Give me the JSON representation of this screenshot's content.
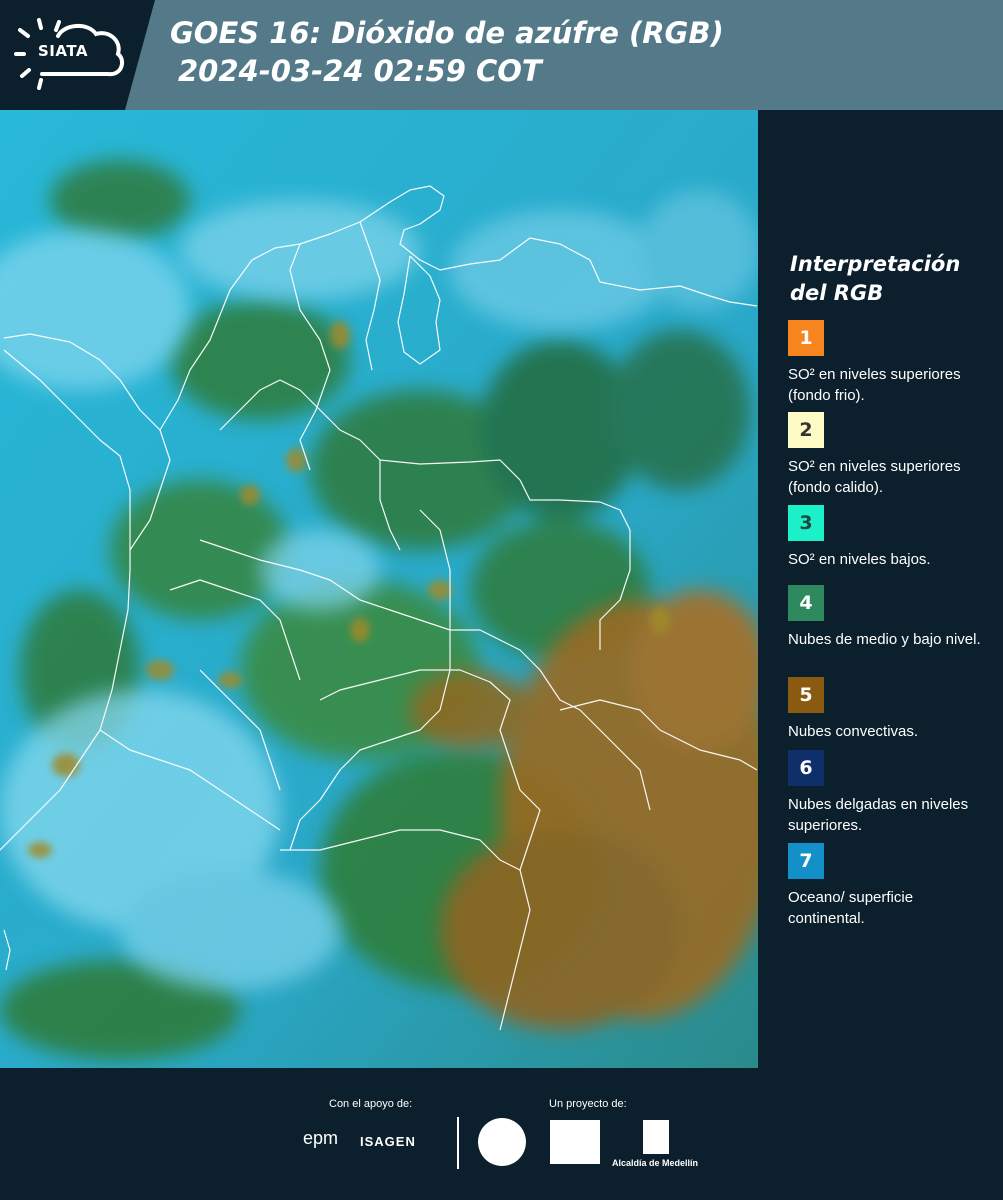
{
  "header": {
    "logo_text": "SIATA",
    "title_line1": "GOES 16: Dióxido de azúfre (RGB)",
    "title_line2": "2024-03-24 02:59 COT"
  },
  "legend": {
    "title_line1": "Interpretación",
    "title_line2": "del RGB",
    "items": [
      {
        "number": "1",
        "color": "#f7841c",
        "text_color": "#ffffff",
        "label": "SO² en niveles superiores (fondo frio)."
      },
      {
        "number": "2",
        "color": "#fffbc4",
        "text_color": "#333333",
        "label": "SO² en niveles superiores (fondo calido)."
      },
      {
        "number": "3",
        "color": "#1cf0c8",
        "text_color": "#1a4a40",
        "label": "SO² en niveles bajos."
      },
      {
        "number": "4",
        "color": "#2e8a5e",
        "text_color": "#ffffff",
        "label": "Nubes de medio y bajo nivel."
      },
      {
        "number": "5",
        "color": "#8a5a10",
        "text_color": "#ffffff",
        "label": "Nubes convectivas."
      },
      {
        "number": "6",
        "color": "#0e2f6a",
        "text_color": "#ffffff",
        "label": "Nubes delgadas en niveles superiores."
      },
      {
        "number": "7",
        "color": "#1390c8",
        "text_color": "#ffffff",
        "label": "Oceano/ superficie continental."
      }
    ]
  },
  "footer": {
    "support_label": "Con el apoyo de:",
    "project_label": "Un proyecto de:",
    "epm": "epm",
    "isagen": "ISAGEN",
    "alcaldia": "Alcaldía de Medellín"
  },
  "colors": {
    "header_bg": "#547a8a",
    "panel_bg": "#0b1f2c",
    "sky": "#25b6d6",
    "cloud": "#7fd8ee",
    "green": "#2f7c3a",
    "brown": "#9a6a20"
  }
}
